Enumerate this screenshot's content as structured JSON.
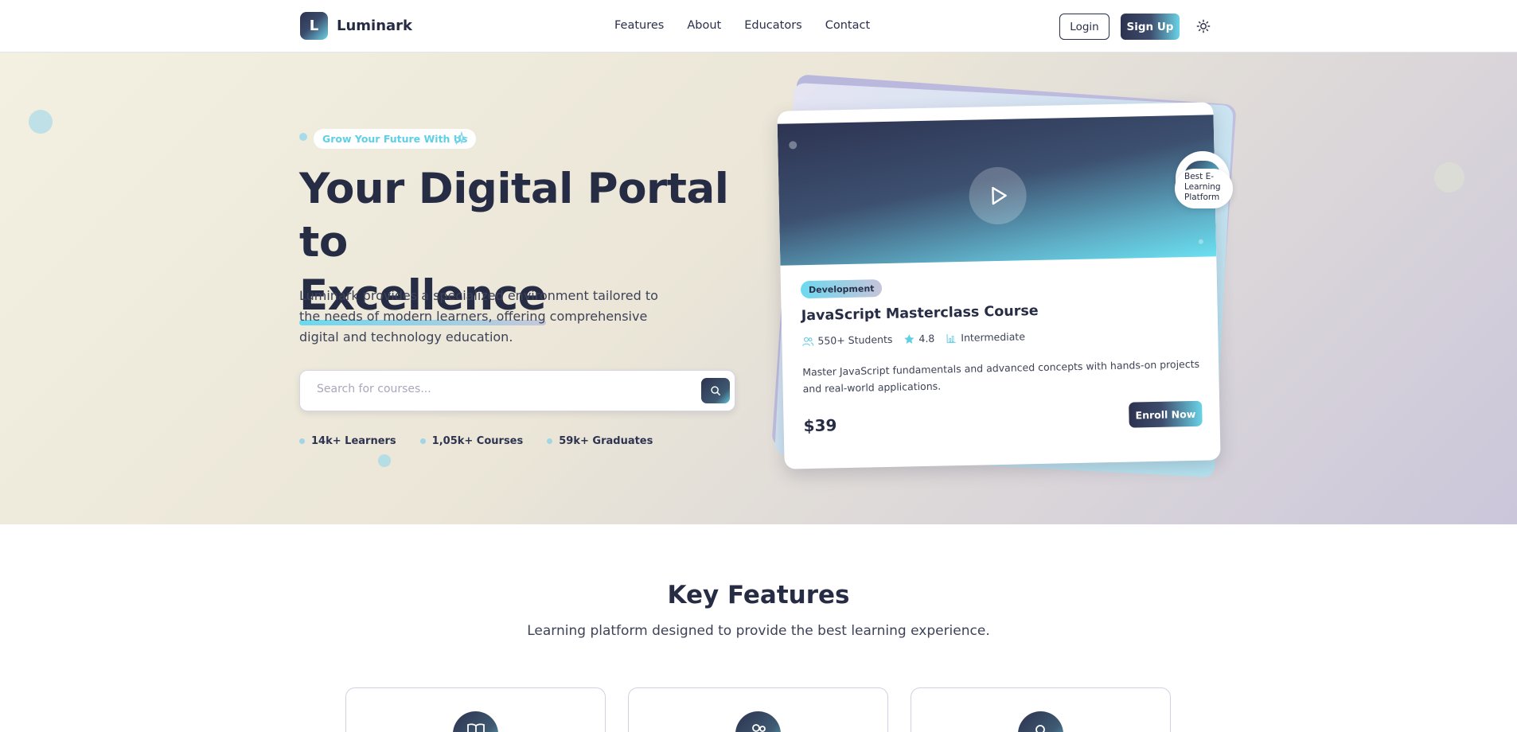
{
  "brand": {
    "logo_letter": "L",
    "name": "Luminark"
  },
  "nav": {
    "links": [
      "Features",
      "About",
      "Educators",
      "Contact"
    ],
    "login_label": "Login",
    "signup_label": "Sign Up",
    "theme_icon": "sun-icon"
  },
  "hero": {
    "tagline": "Grow Your Future With Us",
    "title_line1": "Your Digital Portal to",
    "title_line2": "Excellence",
    "description": "Luminark provides a specialized environment tailored to the needs of modern learners, offering comprehensive digital and technology education.",
    "search_placeholder": "Search for courses...",
    "stats": [
      "14k+ Learners",
      "1,05k+ Courses",
      "59k+ Graduates"
    ]
  },
  "course_card": {
    "tag": "Development",
    "title": "JavaScript Masterclass Course",
    "students": "550+ Students",
    "rating": "4.8",
    "level": "Intermediate",
    "description": "Master JavaScript fundamentals and advanced concepts with hands-on projects and real-world applications.",
    "price": "$39",
    "enroll_label": "Enroll Now",
    "badge": "Best E-Learning Platform"
  },
  "features": {
    "title": "Key Features",
    "subtitle": "Learning platform designed to provide the best learning experience.",
    "card_icons": [
      "book-icon",
      "users-icon",
      "search-icon"
    ]
  },
  "colors": {
    "primary_dark": "#2c3250",
    "accent_cyan": "#6ad3e6",
    "text": "#272c45"
  }
}
